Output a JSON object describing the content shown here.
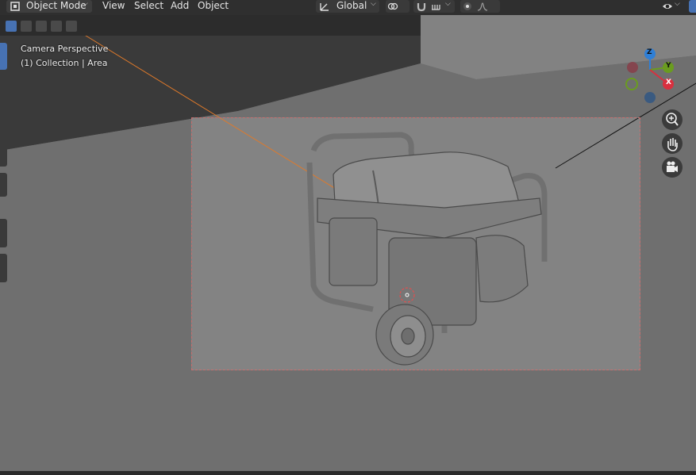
{
  "header": {
    "mode_label": "Object Mode",
    "menus": [
      "View",
      "Select",
      "Add",
      "Object"
    ],
    "transform_orientation": "Global"
  },
  "viewport": {
    "overlay_title": "Camera Perspective",
    "overlay_subtitle": "(1) Collection | Area"
  },
  "gizmo": {
    "axes": [
      {
        "label": "Z",
        "color": "#2f7fd6"
      },
      {
        "label": "Y",
        "color": "#6a9c1f"
      },
      {
        "label": "X",
        "color": "#d8303f"
      }
    ]
  },
  "nav_buttons": [
    "zoom-icon",
    "hand-pan-icon",
    "camera-view-icon"
  ],
  "colors": {
    "accent": "#4772b3",
    "header_bg": "#2f2f2f",
    "viewport_bg": "#6b6b6b"
  }
}
